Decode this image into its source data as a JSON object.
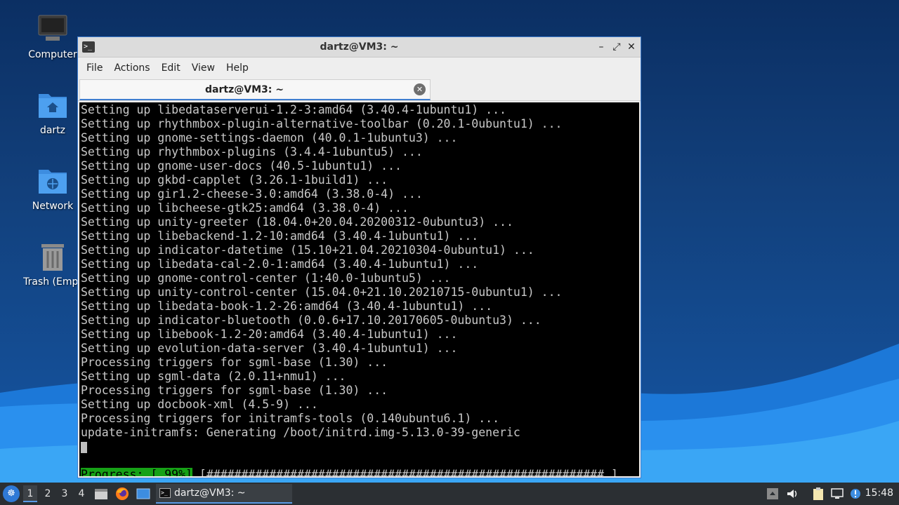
{
  "desktop": {
    "icons": [
      {
        "label": "Computer",
        "icon": "computer-icon"
      },
      {
        "label": "dartz",
        "icon": "home-folder-icon"
      },
      {
        "label": "Network",
        "icon": "network-folder-icon"
      },
      {
        "label": "Trash (Empt",
        "icon": "trash-icon"
      }
    ]
  },
  "window": {
    "title": "dartz@VM3: ~",
    "controls": {
      "minimize": "–",
      "maximize": "⤢",
      "close": "✕"
    },
    "menu": [
      "File",
      "Actions",
      "Edit",
      "View",
      "Help"
    ],
    "tab": {
      "label": "dartz@VM3: ~",
      "close": "✕"
    }
  },
  "terminal": {
    "lines": [
      "Setting up libedataserverui-1.2-3:amd64 (3.40.4-1ubuntu1) ...",
      "Setting up rhythmbox-plugin-alternative-toolbar (0.20.1-0ubuntu1) ...",
      "Setting up gnome-settings-daemon (40.0.1-1ubuntu3) ...",
      "Setting up rhythmbox-plugins (3.4.4-1ubuntu5) ...",
      "Setting up gnome-user-docs (40.5-1ubuntu1) ...",
      "Setting up gkbd-capplet (3.26.1-1build1) ...",
      "Setting up gir1.2-cheese-3.0:amd64 (3.38.0-4) ...",
      "Setting up libcheese-gtk25:amd64 (3.38.0-4) ...",
      "Setting up unity-greeter (18.04.0+20.04.20200312-0ubuntu3) ...",
      "Setting up libebackend-1.2-10:amd64 (3.40.4-1ubuntu1) ...",
      "Setting up indicator-datetime (15.10+21.04.20210304-0ubuntu1) ...",
      "Setting up libedata-cal-2.0-1:amd64 (3.40.4-1ubuntu1) ...",
      "Setting up gnome-control-center (1:40.0-1ubuntu5) ...",
      "Setting up unity-control-center (15.04.0+21.10.20210715-0ubuntu1) ...",
      "Setting up libedata-book-1.2-26:amd64 (3.40.4-1ubuntu1) ...",
      "Setting up indicator-bluetooth (0.0.6+17.10.20170605-0ubuntu3) ...",
      "Setting up libebook-1.2-20:amd64 (3.40.4-1ubuntu1) ...",
      "Setting up evolution-data-server (3.40.4-1ubuntu1) ...",
      "Processing triggers for sgml-base (1.30) ...",
      "Setting up sgml-data (2.0.11+nmu1) ...",
      "Processing triggers for sgml-base (1.30) ...",
      "Setting up docbook-xml (4.5-9) ...",
      "Processing triggers for initramfs-tools (0.140ubuntu6.1) ...",
      "update-initramfs: Generating /boot/initrd.img-5.13.0-39-generic"
    ],
    "progress_label": "Progress: [ 99%]",
    "progress_percent": 99,
    "progress_bar": " [#########################################################.]"
  },
  "taskbar": {
    "start_icon": "start-menu-icon",
    "workspaces": [
      "1",
      "2",
      "3",
      "4"
    ],
    "active_workspace": "1",
    "launchers": [
      "file-manager-icon",
      "firefox-icon",
      "desktop-icon"
    ],
    "task_label": "dartz@VM3: ~",
    "tray": [
      "network-tray-icon",
      "volume-icon",
      "clipboard-icon",
      "display-icon",
      "updates-icon"
    ],
    "clock": "15:48"
  },
  "colors": {
    "accent": "#3f7ed0",
    "progress_green": "#16a116",
    "terminal_bg": "#000000",
    "terminal_fg": "#c8c8c8",
    "taskbar_bg": "#2b2f33"
  }
}
